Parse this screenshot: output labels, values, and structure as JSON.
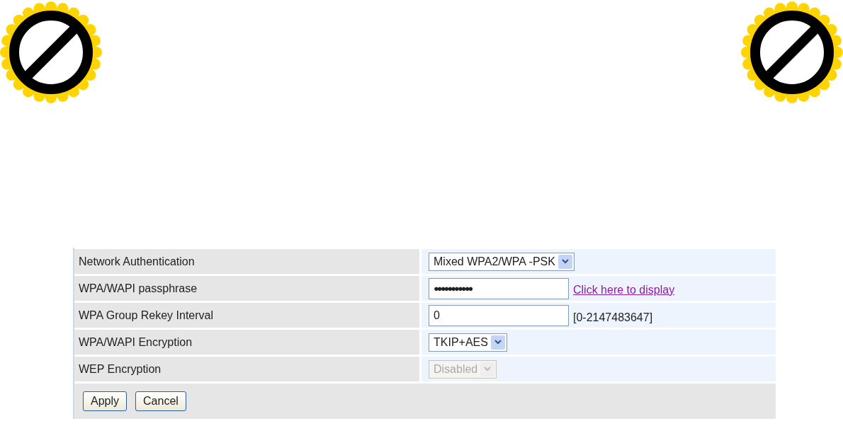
{
  "rows": [
    {
      "label": "Network Authentication",
      "kind": "select",
      "value": "Mixed WPA2/WPA -PSK",
      "disabled": false
    },
    {
      "label": "WPA/WAPI passphrase",
      "kind": "password",
      "value": "●●●●●●●●●●●",
      "link": "Click here to display"
    },
    {
      "label": "WPA Group Rekey Interval",
      "kind": "text",
      "value": "0",
      "hint": "[0-2147483647]"
    },
    {
      "label": "WPA/WAPI Encryption",
      "kind": "select",
      "value": "TKIP+AES",
      "disabled": false
    },
    {
      "label": "WEP Encryption",
      "kind": "select",
      "value": "Disabled",
      "disabled": true
    }
  ],
  "buttons": [
    "Apply",
    "Cancel"
  ]
}
